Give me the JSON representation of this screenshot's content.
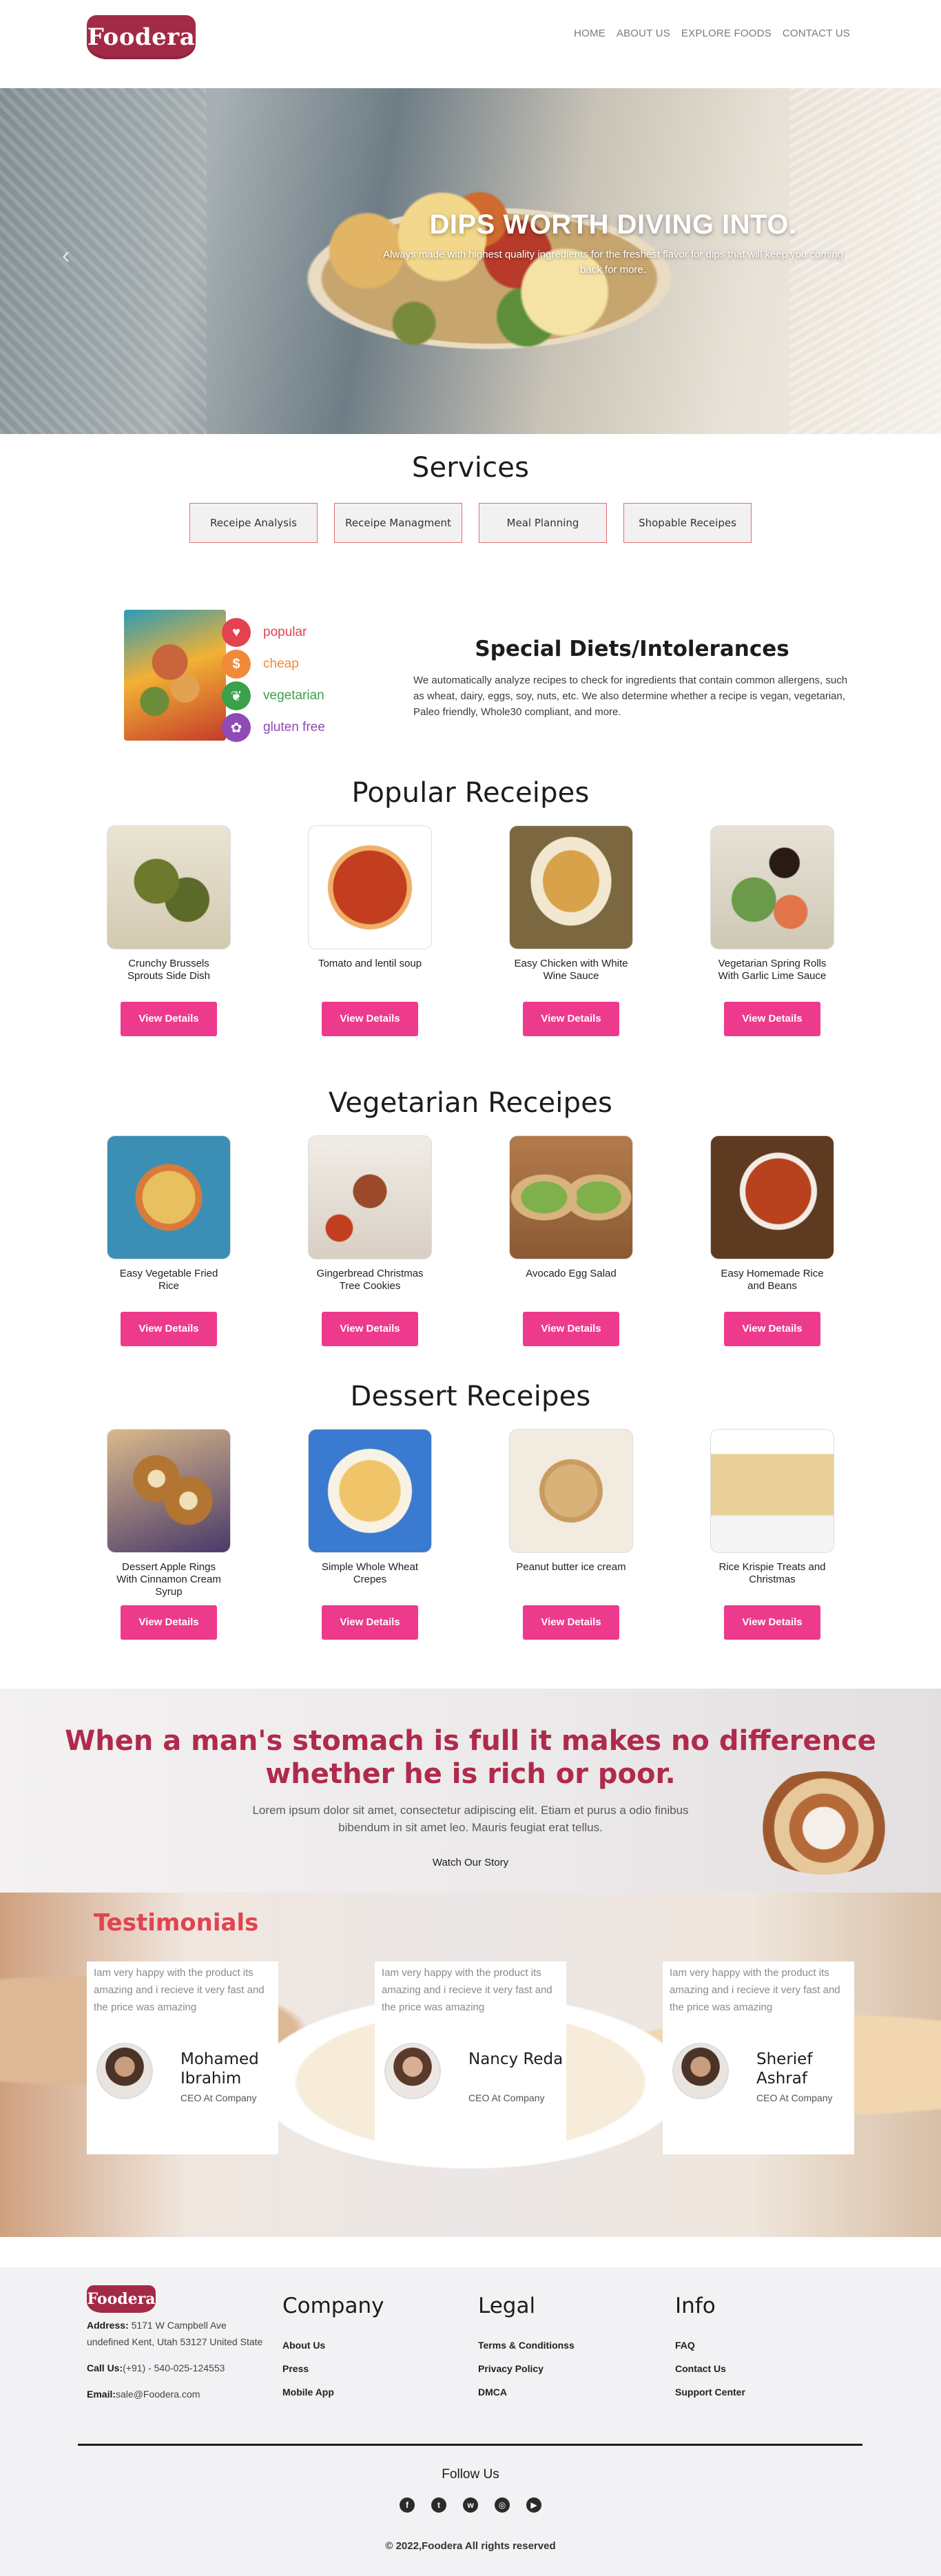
{
  "brand": {
    "logo_text": "Foodera",
    "primary_color": "#a32a47",
    "accent_color": "#ee3a8c"
  },
  "nav": {
    "items": [
      "HOME",
      "ABOUT US",
      "EXPLORE FOODS",
      "CONTACT US"
    ]
  },
  "hero": {
    "title": "DIPS WORTH DIVING INTO.",
    "text": "Always made with highest quality ingredients for the freshest flavor for dips that will keep you coming back for more.",
    "prev_icon": "‹",
    "next_icon": "›"
  },
  "services": {
    "title": "Services",
    "items": [
      "Receipe Analysis",
      "Receipe Managment",
      "Meal Planning",
      "Shopable Receipes"
    ]
  },
  "diets": {
    "title": "Special Diets/Intolerances",
    "text": "We automatically analyze recipes to check for ingredients that contain common allergens, such as wheat, dairy, eggs, soy, nuts, etc. We also determine whether a recipe is vegan, vegetarian, Paleo friendly, Whole30 compliant, and more.",
    "tags": [
      {
        "label": "popular",
        "icon": "heart-icon",
        "glyph": "♥",
        "color": "#e2434f"
      },
      {
        "label": "cheap",
        "icon": "dollar-icon",
        "glyph": "$",
        "color": "#f08a3a"
      },
      {
        "label": "vegetarian",
        "icon": "leaf-icon",
        "glyph": "❦",
        "color": "#3aa14a"
      },
      {
        "label": "gluten free",
        "icon": "wheat-icon",
        "glyph": "✿",
        "color": "#8e4bb5"
      }
    ]
  },
  "sections": [
    {
      "title": "Popular Receipes",
      "button": "View Details",
      "recipes": [
        {
          "name": "Crunchy Brussels Sprouts Side Dish",
          "colors": [
            "#6d7a2e",
            "#e9e4d4"
          ]
        },
        {
          "name": "Tomato and lentil soup",
          "colors": [
            "#c23e1e",
            "#f0b06a"
          ]
        },
        {
          "name": "Easy Chicken with White Wine Sauce",
          "colors": [
            "#d8a24a",
            "#7c6840"
          ]
        },
        {
          "name": "Vegetarian Spring Rolls With Garlic Lime Sauce",
          "colors": [
            "#6a9a4a",
            "#e7e2d6"
          ]
        }
      ]
    },
    {
      "title": "Vegetarian Receipes",
      "button": "View Details",
      "recipes": [
        {
          "name": "Easy Vegetable Fried Rice",
          "colors": [
            "#e9c060",
            "#3b8fb4"
          ]
        },
        {
          "name": "Gingerbread Christmas Tree Cookies",
          "colors": [
            "#9a4a2a",
            "#f1ece6"
          ]
        },
        {
          "name": "Avocado Egg Salad",
          "colors": [
            "#7fb04a",
            "#b47b4c"
          ]
        },
        {
          "name": "Easy Homemade Rice and Beans",
          "colors": [
            "#b8421e",
            "#5e3a20"
          ]
        }
      ]
    },
    {
      "title": "Dessert Receipes",
      "button": "View Details",
      "recipes": [
        {
          "name": "Dessert Apple Rings With Cinnamon Cream Syrup",
          "colors": [
            "#b27532",
            "#4a3a6a"
          ]
        },
        {
          "name": "Simple Whole Wheat Crepes",
          "colors": [
            "#f0c56a",
            "#3a7ad0"
          ]
        },
        {
          "name": "Peanut butter ice cream",
          "colors": [
            "#d9b27a",
            "#f2ebe0"
          ]
        },
        {
          "name": "Rice Krispie Treats and Christmas",
          "colors": [
            "#e9cf98",
            "#f5f5f5"
          ]
        }
      ]
    }
  ],
  "quote": {
    "text": "When a man's stomach is full it makes no difference whether he is rich or poor.",
    "sub": "Lorem ipsum dolor sit amet, consectetur adipiscing elit. Etiam et purus a odio finibus bibendum in sit amet leo. Mauris feugiat erat tellus.",
    "link": "Watch Our Story"
  },
  "testimonials": {
    "title": "Testimonials",
    "items": [
      {
        "quote": "Iam very happy with the product its amazing and i recieve it very fast and the price was amazing",
        "name": "Mohamed Ibrahim",
        "role": "CEO At Company"
      },
      {
        "quote": "Iam very happy with the product its amazing and i recieve it very fast and the price was amazing",
        "name": "Nancy Reda",
        "role": "CEO At Company"
      },
      {
        "quote": "Iam very happy with the product its amazing and i recieve it very fast and the price was amazing",
        "name": "Sherief Ashraf",
        "role": "CEO At Company"
      }
    ]
  },
  "footer": {
    "logo_text": "Foodera",
    "address_label": "Address:",
    "address": "5171 W Campbell Ave undefined Kent, Utah 53127 United State",
    "call_label": "Call Us:",
    "call": "(+91) - 540-025-124553",
    "email_label": "Email:",
    "email": "sale@Foodera.com",
    "columns": [
      {
        "title": "Company",
        "links": [
          "About Us",
          "Press",
          "Mobile App"
        ]
      },
      {
        "title": "Legal",
        "links": [
          "Terms & Conditionss",
          "Privacy Policy",
          "DMCA"
        ]
      },
      {
        "title": "Info",
        "links": [
          "FAQ",
          "Contact Us",
          "Support Center"
        ]
      }
    ],
    "follow": "Follow Us",
    "socials": [
      {
        "icon": "facebook-icon",
        "glyph": "f"
      },
      {
        "icon": "twitter-icon",
        "glyph": "t"
      },
      {
        "icon": "whatsapp-icon",
        "glyph": "w"
      },
      {
        "icon": "instagram-icon",
        "glyph": "◎"
      },
      {
        "icon": "youtube-icon",
        "glyph": "▶"
      }
    ],
    "copyright": "© 2022,Foodera All rights reserved"
  }
}
